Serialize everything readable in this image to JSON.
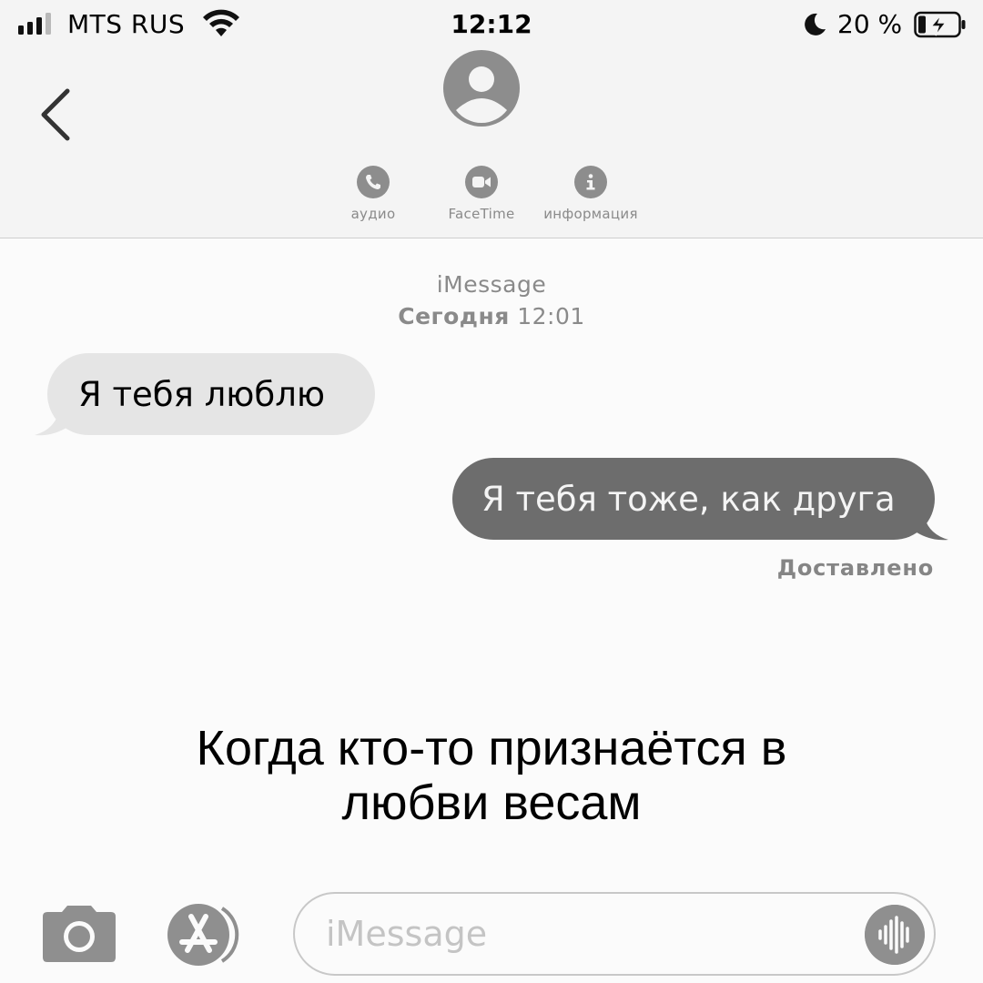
{
  "status_bar": {
    "carrier": "MTS RUS",
    "time": "12:12",
    "battery_percent": "20 %",
    "signal_bars_filled": 3,
    "signal_bars_total": 4
  },
  "header": {
    "actions": [
      {
        "label": "аудио",
        "icon": "phone-icon"
      },
      {
        "label": "FaceTime",
        "icon": "video-camera-icon"
      },
      {
        "label": "информация",
        "icon": "info-icon"
      }
    ]
  },
  "conversation": {
    "service": "iMessage",
    "date_day": "Сегодня",
    "date_time": "12:01",
    "messages": [
      {
        "direction": "incoming",
        "text": "Я тебя люблю"
      },
      {
        "direction": "outgoing",
        "text": "Я тебя тоже, как друга"
      }
    ],
    "status": "Доставлено"
  },
  "caption": {
    "line1": "Когда кто-то признаётся в",
    "line2": "любви весам"
  },
  "input_bar": {
    "placeholder": "iMessage"
  },
  "colors": {
    "incoming_bubble": "#e5e5e5",
    "outgoing_bubble": "#6d6d6d",
    "header_bg": "#f4f4f4"
  }
}
